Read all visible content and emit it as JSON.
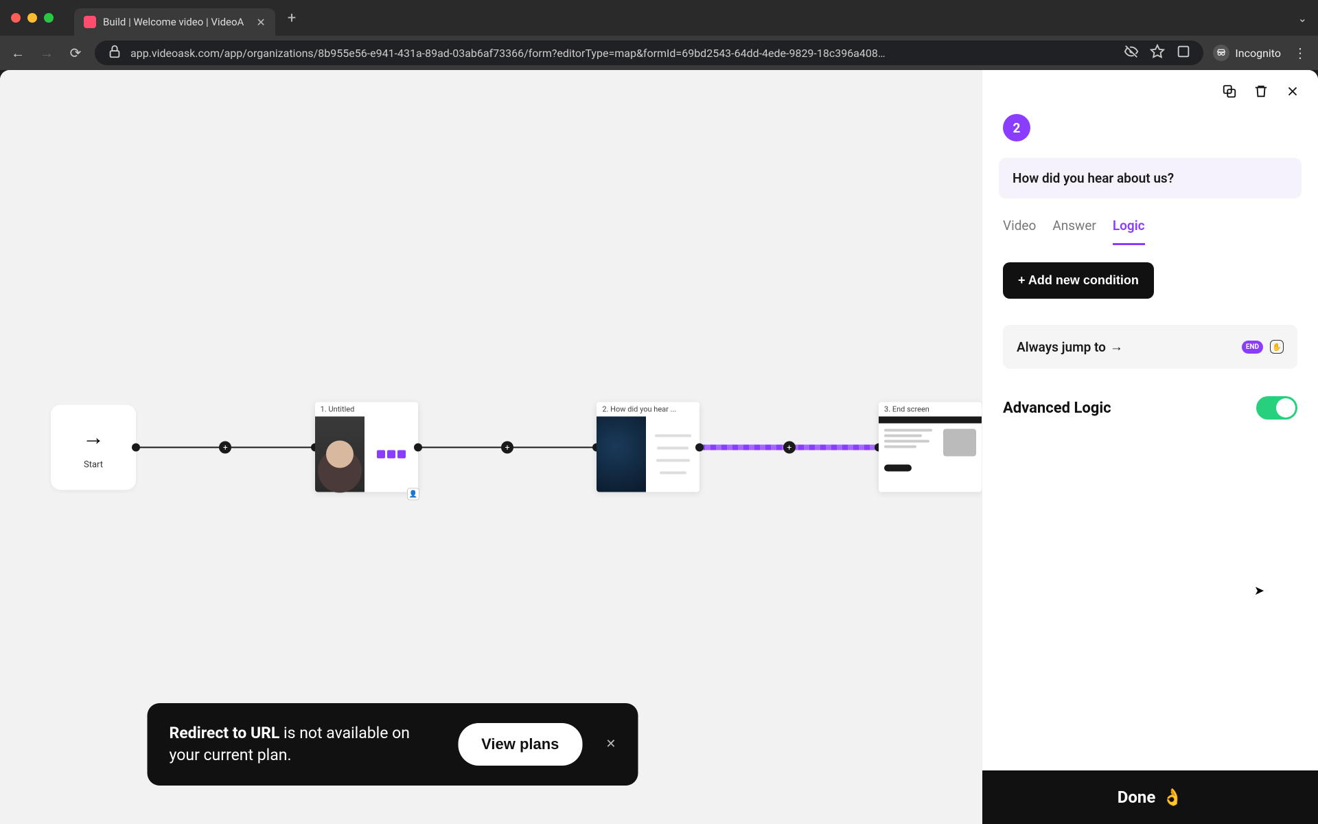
{
  "browser": {
    "tab_title": "Build | Welcome video | VideoA",
    "url": "app.videoask.com/app/organizations/8b955e56-e941-431a-89ad-03ab6af73366/form?editorType=map&formId=69bd2543-64dd-4ede-9829-18c396a408…",
    "incognito_label": "Incognito"
  },
  "flow": {
    "start_label": "Start",
    "nodes": [
      {
        "label": "1. Untitled"
      },
      {
        "label": "2. How did you hear ..."
      },
      {
        "label": "3. End screen"
      }
    ]
  },
  "panel": {
    "step_number": "2",
    "question": "How did you hear about us?",
    "tabs": {
      "video": "Video",
      "answer": "Answer",
      "logic": "Logic",
      "active": "logic"
    },
    "add_condition_label": "+ Add new condition",
    "always_jump_label": "Always jump to",
    "always_jump_arrow": "→",
    "end_pill": "END",
    "advanced_label": "Advanced Logic",
    "advanced_on": true,
    "done_label": "Done",
    "done_emoji": "👌"
  },
  "toast": {
    "bold": "Redirect to URL",
    "rest": " is not available on your current plan.",
    "cta": "View plans"
  }
}
